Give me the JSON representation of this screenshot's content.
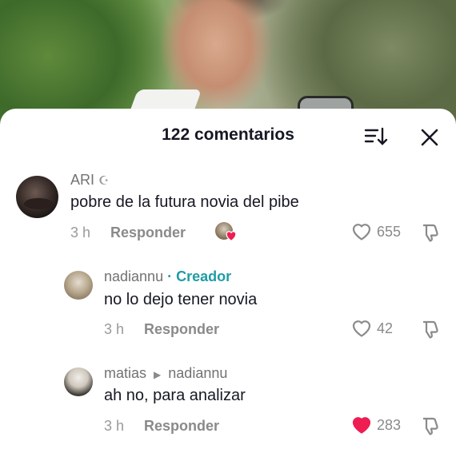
{
  "header": {
    "title": "122 comentarios"
  },
  "comments": [
    {
      "username": "ARI",
      "username_suffix": "☪",
      "text": "pobre de la futura novia del pibe",
      "time": "3 h",
      "reply_label": "Responder",
      "likes": "655",
      "liked": false
    },
    {
      "username": "nadiannu",
      "creator_label": "· Creador",
      "text": "no lo dejo tener novia",
      "time": "3 h",
      "reply_label": "Responder",
      "likes": "42",
      "liked": false
    },
    {
      "username": "matias",
      "reply_to": "nadiannu",
      "text": "ah no, para analizar",
      "time": "3 h",
      "reply_label": "Responder",
      "likes": "283",
      "liked": true
    }
  ],
  "colors": {
    "accent_creator": "#1f9ca6",
    "like_red": "#ee1d52"
  }
}
